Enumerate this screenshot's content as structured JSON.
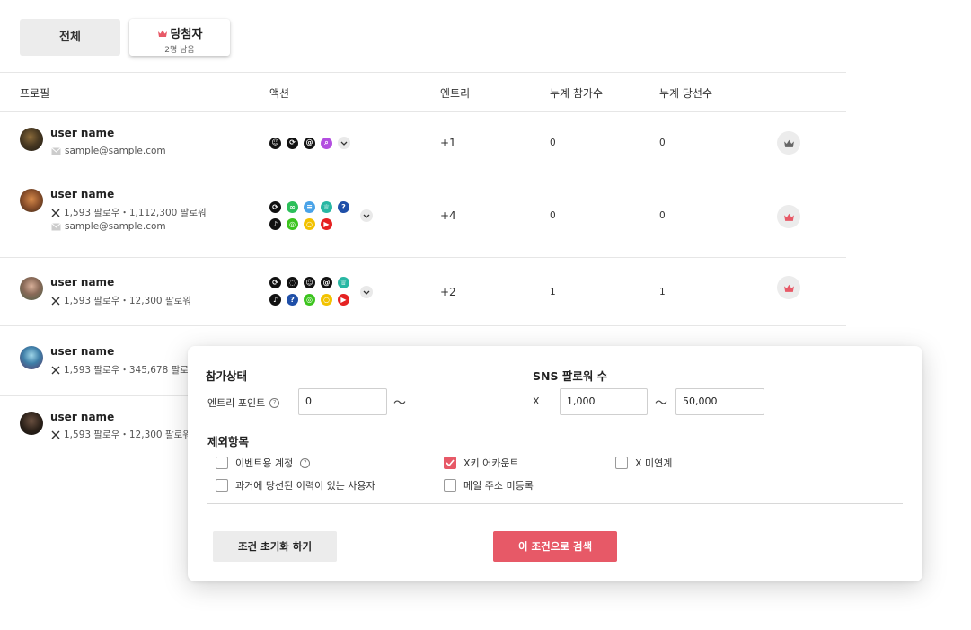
{
  "tabs": {
    "all": "전체",
    "winner": "당첨자",
    "winner_sub": "2명 남음"
  },
  "columns": {
    "profile": "프로필",
    "action": "액션",
    "entry": "엔트리",
    "total_participation": "누계 참가수",
    "total_wins": "누계 당선수"
  },
  "rows": [
    {
      "name": "user name",
      "line1": "sample@sample.com",
      "line1_icon": "mail-icon",
      "line2": "",
      "entry": "+1",
      "participation": "0",
      "wins": "0",
      "winner": false
    },
    {
      "name": "user name",
      "line1": "1,593 팔로우・1,112,300 팔로워",
      "line1_icon": "x-logo-icon",
      "line2": "sample@sample.com",
      "entry": "+4",
      "participation": "0",
      "wins": "0",
      "winner": true
    },
    {
      "name": "user name",
      "line1": "1,593 팔로우・12,300 팔로워",
      "line1_icon": "x-logo-icon",
      "line2": "",
      "entry": "+2",
      "participation": "1",
      "wins": "1",
      "winner": true
    },
    {
      "name": "user name",
      "line1": "1,593 팔로우・345,678 팔로워",
      "line1_icon": "x-logo-icon",
      "line2": ""
    },
    {
      "name": "user name",
      "line1": "1,593 팔로우・12,300 팔로워",
      "line1_icon": "x-logo-icon",
      "line2": ""
    }
  ],
  "filter": {
    "status_title": "참가상태",
    "entry_point_label": "엔트리 포인트",
    "entry_from": "0",
    "tilde": "〜",
    "sns_title": "SNS 팔로워 수",
    "x_label": "X",
    "followers_from": "1,000",
    "followers_to": "50,000",
    "exclude_title": "제외항목",
    "options": [
      {
        "label": "이벤트용 계정",
        "checked": false
      },
      {
        "label": "X키 어카운트",
        "checked": true
      },
      {
        "label": "X 미연계",
        "checked": false
      },
      {
        "label": "과거에 당선된 이력이 있는 사용자",
        "checked": false
      },
      {
        "label": "메일 주소 미등록",
        "checked": false
      }
    ],
    "reset_label": "조건 초기화 하기",
    "search_label": "이 조건으로 검색"
  },
  "colors": {
    "accent": "#e75967",
    "crown_inactive": "#666666"
  }
}
